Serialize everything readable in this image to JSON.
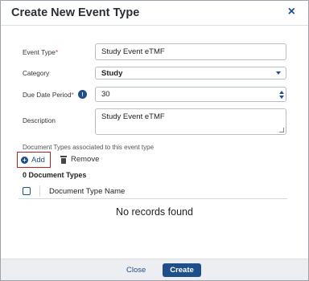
{
  "dialog": {
    "title": "Create New Event Type",
    "close_icon": "×"
  },
  "form": {
    "event_type": {
      "label": "Event Type",
      "required_mark": "*",
      "value": "Study Event eTMF"
    },
    "category": {
      "label": "Category",
      "value": "Study"
    },
    "due_date_period": {
      "label": "Due Date Period",
      "required_mark": "*",
      "info_icon": "!",
      "value": "30"
    },
    "description": {
      "label": "Description",
      "value": "Study Event eTMF"
    }
  },
  "document_types": {
    "section_label": "Document Types associated to this event type",
    "add_label": "Add",
    "remove_label": "Remove",
    "count_label": "0 Document Types",
    "column_header": "Document Type Name",
    "empty_message": "No records found"
  },
  "footer": {
    "close_label": "Close",
    "create_label": "Create"
  },
  "colors": {
    "primary": "#1f4f8a",
    "required": "#e03131",
    "highlight_border": "#b52424"
  },
  "icons": {
    "close": "close-icon",
    "info": "info-icon",
    "add": "plus-circle-icon",
    "remove": "trash-icon",
    "dropdown": "chevron-down-icon",
    "stepper": "spinner-arrows-icon"
  }
}
